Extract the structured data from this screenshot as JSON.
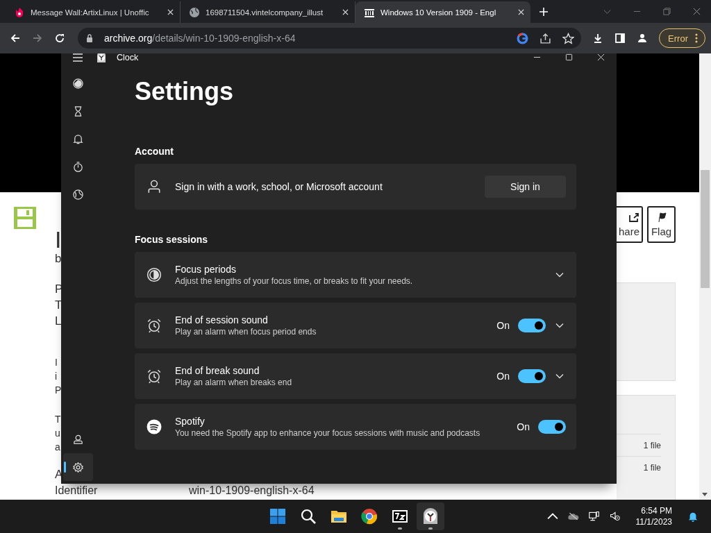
{
  "browser": {
    "tabs": [
      {
        "title": "Message Wall:ArtixLinux | Unoffic",
        "kind": "fandom",
        "selected": false
      },
      {
        "title": "1698711504.vintelcompany_illust",
        "kind": "globe",
        "selected": false
      },
      {
        "title": "Windows 10 Version 1909 - Engl",
        "kind": "archive",
        "selected": true
      }
    ],
    "address": {
      "domain": "archive.org",
      "path": "/details/win-10-1909-english-x-64"
    },
    "profile_button": "Error"
  },
  "page": {
    "title_fragments": [
      "I"
    ],
    "byline": "b",
    "paragraphs": [
      {
        "kind": "large",
        "lines": [
          "P",
          "T",
          "L"
        ]
      },
      {
        "kind": "small",
        "lines": [
          "I",
          "i",
          "P"
        ]
      },
      {
        "kind": "small",
        "lines": [
          "T",
          "u",
          "a"
        ]
      },
      {
        "kind": "large",
        "lines": [
          "A"
        ]
      }
    ],
    "metadata": [
      {
        "label": "Identifier",
        "value": "win-10-1909-english-x-64"
      }
    ],
    "actions": [
      {
        "kind": "share",
        "label": "hare"
      },
      {
        "kind": "flag",
        "label": "Flag"
      }
    ],
    "file_counts": [
      "1 file",
      "1 file"
    ]
  },
  "clock": {
    "title": "Clock",
    "nav": [
      {
        "kind": "focus",
        "selected": false
      },
      {
        "kind": "timer",
        "selected": false
      },
      {
        "kind": "alarm",
        "selected": false
      },
      {
        "kind": "stopwatch",
        "selected": false
      },
      {
        "kind": "world",
        "selected": false
      },
      {
        "kind": "account",
        "selected": false
      },
      {
        "kind": "settings",
        "selected": true
      }
    ],
    "heading": "Settings",
    "sections": [
      {
        "title": "Account",
        "rows": [
          {
            "kind": "person",
            "title": "Sign in with a work, school, or Microsoft account",
            "button": "Sign in"
          }
        ]
      },
      {
        "title": "Focus sessions",
        "rows": [
          {
            "kind": "focus",
            "title": "Focus periods",
            "subtitle": "Adjust the lengths of your focus time, or breaks to fit your needs.",
            "expandable": true
          },
          {
            "kind": "alarm",
            "title": "End of session sound",
            "subtitle": "Play an alarm when focus period ends",
            "toggle": {
              "label": "On",
              "on": true
            },
            "expandable": true
          },
          {
            "kind": "alarm",
            "title": "End of break sound",
            "subtitle": "Play an alarm when breaks end",
            "toggle": {
              "label": "On",
              "on": true
            },
            "expandable": true
          },
          {
            "kind": "spotify",
            "title": "Spotify",
            "subtitle": "You need the Spotify app to enhance your focus sessions with music and podcasts",
            "toggle": {
              "label": "On",
              "on": true
            },
            "expandable": false
          }
        ]
      }
    ]
  },
  "taskbar": {
    "apps": [
      {
        "kind": "start",
        "running": false
      },
      {
        "kind": "search",
        "running": false
      },
      {
        "kind": "explorer",
        "running": false
      },
      {
        "kind": "chrome",
        "running": false
      },
      {
        "kind": "archiver",
        "running": true
      },
      {
        "kind": "clock",
        "running": true
      }
    ],
    "time": "6:54 PM",
    "date": "11/1/2023"
  }
}
